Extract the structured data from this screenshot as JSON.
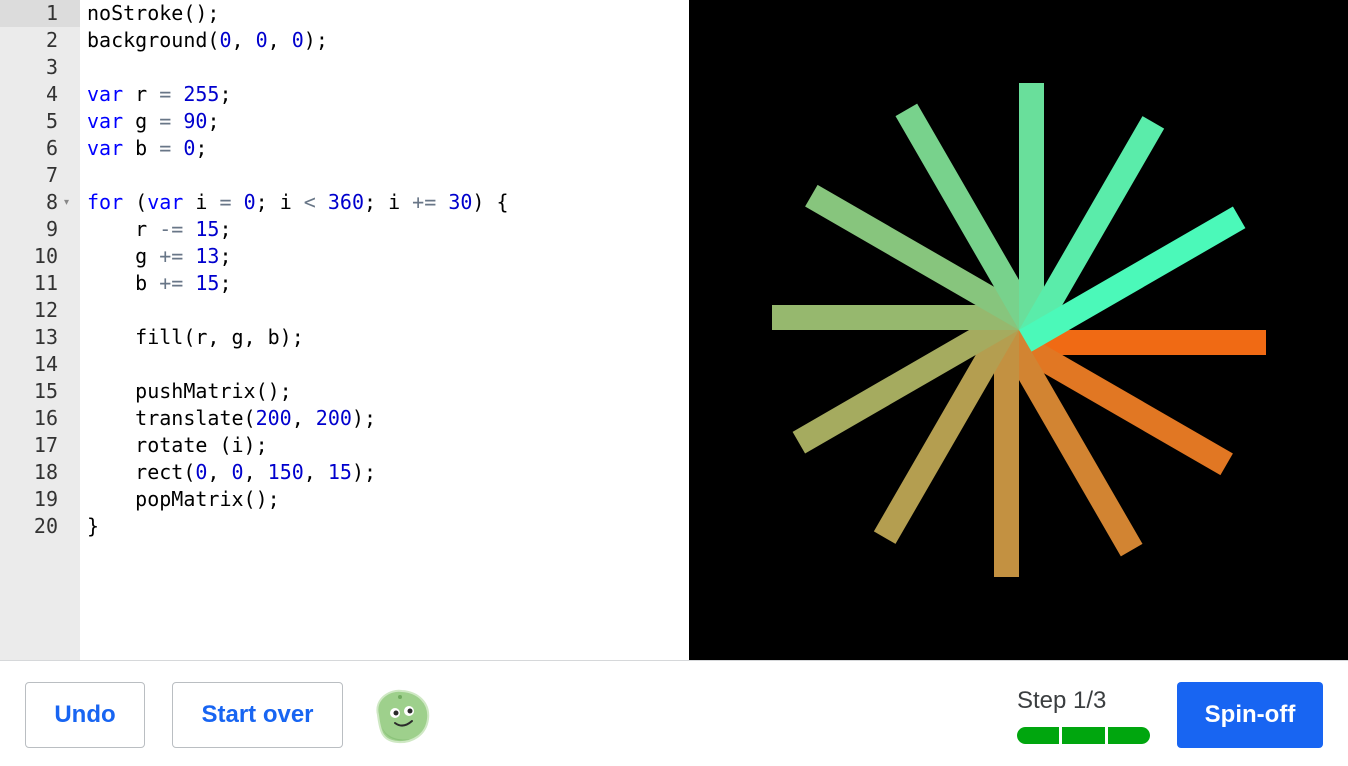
{
  "editor": {
    "line_numbers": [
      "1",
      "2",
      "3",
      "4",
      "5",
      "6",
      "7",
      "8",
      "9",
      "10",
      "11",
      "12",
      "13",
      "14",
      "15",
      "16",
      "17",
      "18",
      "19",
      "20"
    ],
    "fold_marker": "▾",
    "lines": [
      [
        [
          "noStroke();",
          "p"
        ]
      ],
      [
        [
          "background(",
          "p"
        ],
        [
          "0",
          "num"
        ],
        [
          ", ",
          "p"
        ],
        [
          "0",
          "num"
        ],
        [
          ", ",
          "p"
        ],
        [
          "0",
          "num"
        ],
        [
          ");",
          "p"
        ]
      ],
      [],
      [
        [
          "var",
          "kw"
        ],
        [
          " r ",
          "p"
        ],
        [
          "=",
          "op"
        ],
        [
          " ",
          "p"
        ],
        [
          "255",
          "num"
        ],
        [
          ";",
          "p"
        ]
      ],
      [
        [
          "var",
          "kw"
        ],
        [
          " g ",
          "p"
        ],
        [
          "=",
          "op"
        ],
        [
          " ",
          "p"
        ],
        [
          "90",
          "num"
        ],
        [
          ";",
          "p"
        ]
      ],
      [
        [
          "var",
          "kw"
        ],
        [
          " b ",
          "p"
        ],
        [
          "=",
          "op"
        ],
        [
          " ",
          "p"
        ],
        [
          "0",
          "num"
        ],
        [
          ";",
          "p"
        ]
      ],
      [],
      [
        [
          "for",
          "kw"
        ],
        [
          " (",
          "p"
        ],
        [
          "var",
          "kw"
        ],
        [
          " i ",
          "p"
        ],
        [
          "=",
          "op"
        ],
        [
          " ",
          "p"
        ],
        [
          "0",
          "num"
        ],
        [
          "; i ",
          "p"
        ],
        [
          "<",
          "op"
        ],
        [
          " ",
          "p"
        ],
        [
          "360",
          "num"
        ],
        [
          "; i ",
          "p"
        ],
        [
          "+=",
          "op"
        ],
        [
          " ",
          "p"
        ],
        [
          "30",
          "num"
        ],
        [
          ") {",
          "p"
        ]
      ],
      [
        [
          "    r ",
          "p"
        ],
        [
          "-=",
          "op"
        ],
        [
          " ",
          "p"
        ],
        [
          "15",
          "num"
        ],
        [
          ";",
          "p"
        ]
      ],
      [
        [
          "    g ",
          "p"
        ],
        [
          "+=",
          "op"
        ],
        [
          " ",
          "p"
        ],
        [
          "13",
          "num"
        ],
        [
          ";",
          "p"
        ]
      ],
      [
        [
          "    b ",
          "p"
        ],
        [
          "+=",
          "op"
        ],
        [
          " ",
          "p"
        ],
        [
          "15",
          "num"
        ],
        [
          ";",
          "p"
        ]
      ],
      [],
      [
        [
          "    fill(r, g, b);",
          "p"
        ]
      ],
      [],
      [
        [
          "    pushMatrix();",
          "p"
        ]
      ],
      [
        [
          "    translate(",
          "p"
        ],
        [
          "200",
          "num"
        ],
        [
          ", ",
          "p"
        ],
        [
          "200",
          "num"
        ],
        [
          ");",
          "p"
        ]
      ],
      [
        [
          "    rotate (i);",
          "p"
        ]
      ],
      [
        [
          "    rect(",
          "p"
        ],
        [
          "0",
          "num"
        ],
        [
          ", ",
          "p"
        ],
        [
          "0",
          "num"
        ],
        [
          ", ",
          "p"
        ],
        [
          "150",
          "num"
        ],
        [
          ", ",
          "p"
        ],
        [
          "15",
          "num"
        ],
        [
          ");",
          "p"
        ]
      ],
      [
        [
          "    popMatrix();",
          "p"
        ]
      ],
      [
        [
          "}",
          "p"
        ]
      ]
    ]
  },
  "canvas_output": {
    "background": "#000000",
    "rays": [
      {
        "angle_deg": 0,
        "color": "#f06a14"
      },
      {
        "angle_deg": 30,
        "color": "#e17723"
      },
      {
        "angle_deg": 60,
        "color": "#d28432"
      },
      {
        "angle_deg": 90,
        "color": "#c39141"
      },
      {
        "angle_deg": 120,
        "color": "#b49e50"
      },
      {
        "angle_deg": 150,
        "color": "#a5ab5f"
      },
      {
        "angle_deg": 180,
        "color": "#96b86e"
      },
      {
        "angle_deg": 210,
        "color": "#87c57d"
      },
      {
        "angle_deg": 240,
        "color": "#78d28c"
      },
      {
        "angle_deg": 270,
        "color": "#69df9b"
      },
      {
        "angle_deg": 300,
        "color": "#5aecaa"
      },
      {
        "angle_deg": 330,
        "color": "#4bf9b9"
      }
    ]
  },
  "footer": {
    "undo_label": "Undo",
    "start_over_label": "Start over",
    "step_label": "Step 1/3",
    "progress_segments": 3,
    "progress_color": "#00a60e",
    "spinoff_label": "Spin-off",
    "accent": "#1865f2",
    "avatar_icon": "green-blob-avatar"
  }
}
